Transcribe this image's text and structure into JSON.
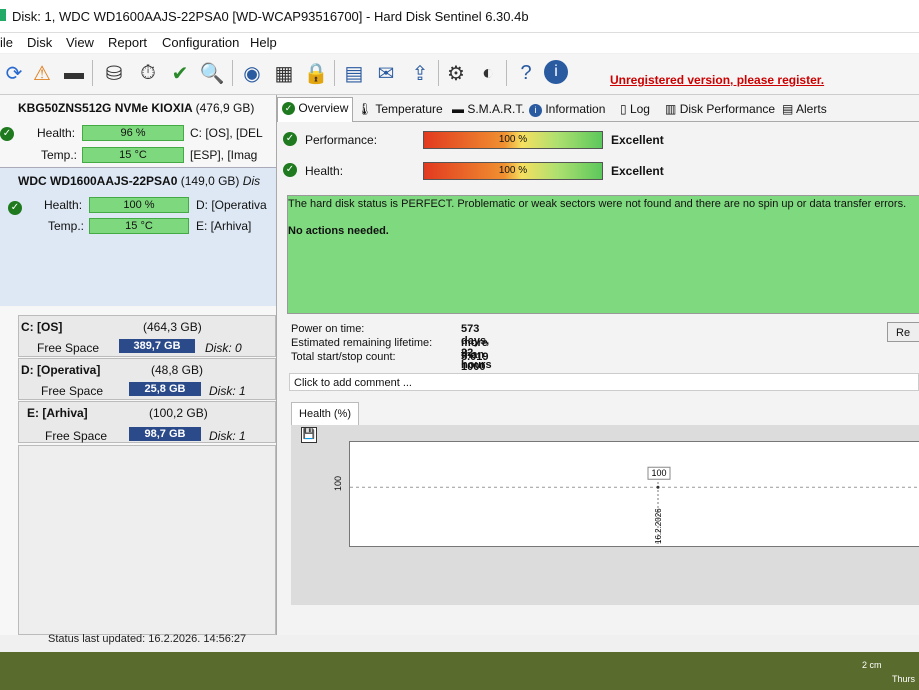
{
  "window": {
    "title": "Disk: 1, WDC WD1600AAJS-22PSA0 [WD-WCAP93516700]  -  Hard Disk Sentinel 6.30.4b"
  },
  "menu": [
    "ile",
    "Disk",
    "View",
    "Report",
    "Configuration",
    "Help"
  ],
  "toolbar": {
    "unregistered": "Unregistered version, please register."
  },
  "disks": [
    {
      "name": "KBG50ZNS512G NVMe KIOXIA",
      "size": "(476,9 GB)",
      "health_label": "Health:",
      "health": "96 %",
      "temp_label": "Temp.:",
      "temp": "15 °C",
      "drives_a": "C: [OS],  [DEL",
      "drives_b": "[ESP],  [Imag"
    },
    {
      "name": "WDC WD1600AAJS-22PSA0",
      "size": "(149,0 GB)",
      "size_suffix": "Dis",
      "health_label": "Health:",
      "health": "100 %",
      "temp_label": "Temp.:",
      "temp": "15 °C",
      "drives_a": "D: [Operativa",
      "drives_b": "E: [Arhiva]"
    }
  ],
  "health_bars": [
    0.96,
    1.0
  ],
  "partitions": [
    {
      "name": "C: [OS]",
      "size": "(464,3 GB)",
      "free_label": "Free Space",
      "free": "389,7 GB",
      "disk": "Disk: 0"
    },
    {
      "name": "D: [Operativa]",
      "size": "(48,8 GB)",
      "free_label": "Free Space",
      "free": "25,8 GB",
      "disk": "Disk: 1"
    },
    {
      "name": "E: [Arhiva]",
      "size": "(100,2 GB)",
      "free_label": "Free Space",
      "free": "98,7 GB",
      "disk": "Disk: 1"
    }
  ],
  "status_bar": "Status last updated: 16.2.2026. 14:56:27",
  "tabs": [
    "Overview",
    "Temperature",
    "S.M.A.R.T.",
    "Information",
    "Log",
    "Disk Performance",
    "Alerts"
  ],
  "overview": {
    "performance_label": "Performance:",
    "performance_value": "100 %",
    "performance_text": "Excellent",
    "health_label": "Health:",
    "health_value": "100 %",
    "health_text": "Excellent",
    "status_message": "The hard disk status is PERFECT. Problematic or weak sectors were not found and there are no spin up or data transfer errors.",
    "actions": "No actions needed.",
    "power_on_label": "Power on time:",
    "power_on": "573 days, 22 hours",
    "lifetime_label": "Estimated remaining lifetime:",
    "lifetime": "more than 1000 days",
    "startstop_label": "Total start/stop count:",
    "startstop": "3.019",
    "comment_placeholder": "Click to add comment ...",
    "re_button": "Re",
    "health_tab": "Health (%)"
  },
  "chart_data": {
    "type": "line",
    "x": [
      "16.2.2026"
    ],
    "series": [
      {
        "values": [
          100
        ]
      }
    ],
    "data_labels": [
      "100"
    ],
    "ylabel_tick": "100"
  },
  "taskbar": {
    "clock": "2 cm",
    "sub": "Thurs"
  }
}
